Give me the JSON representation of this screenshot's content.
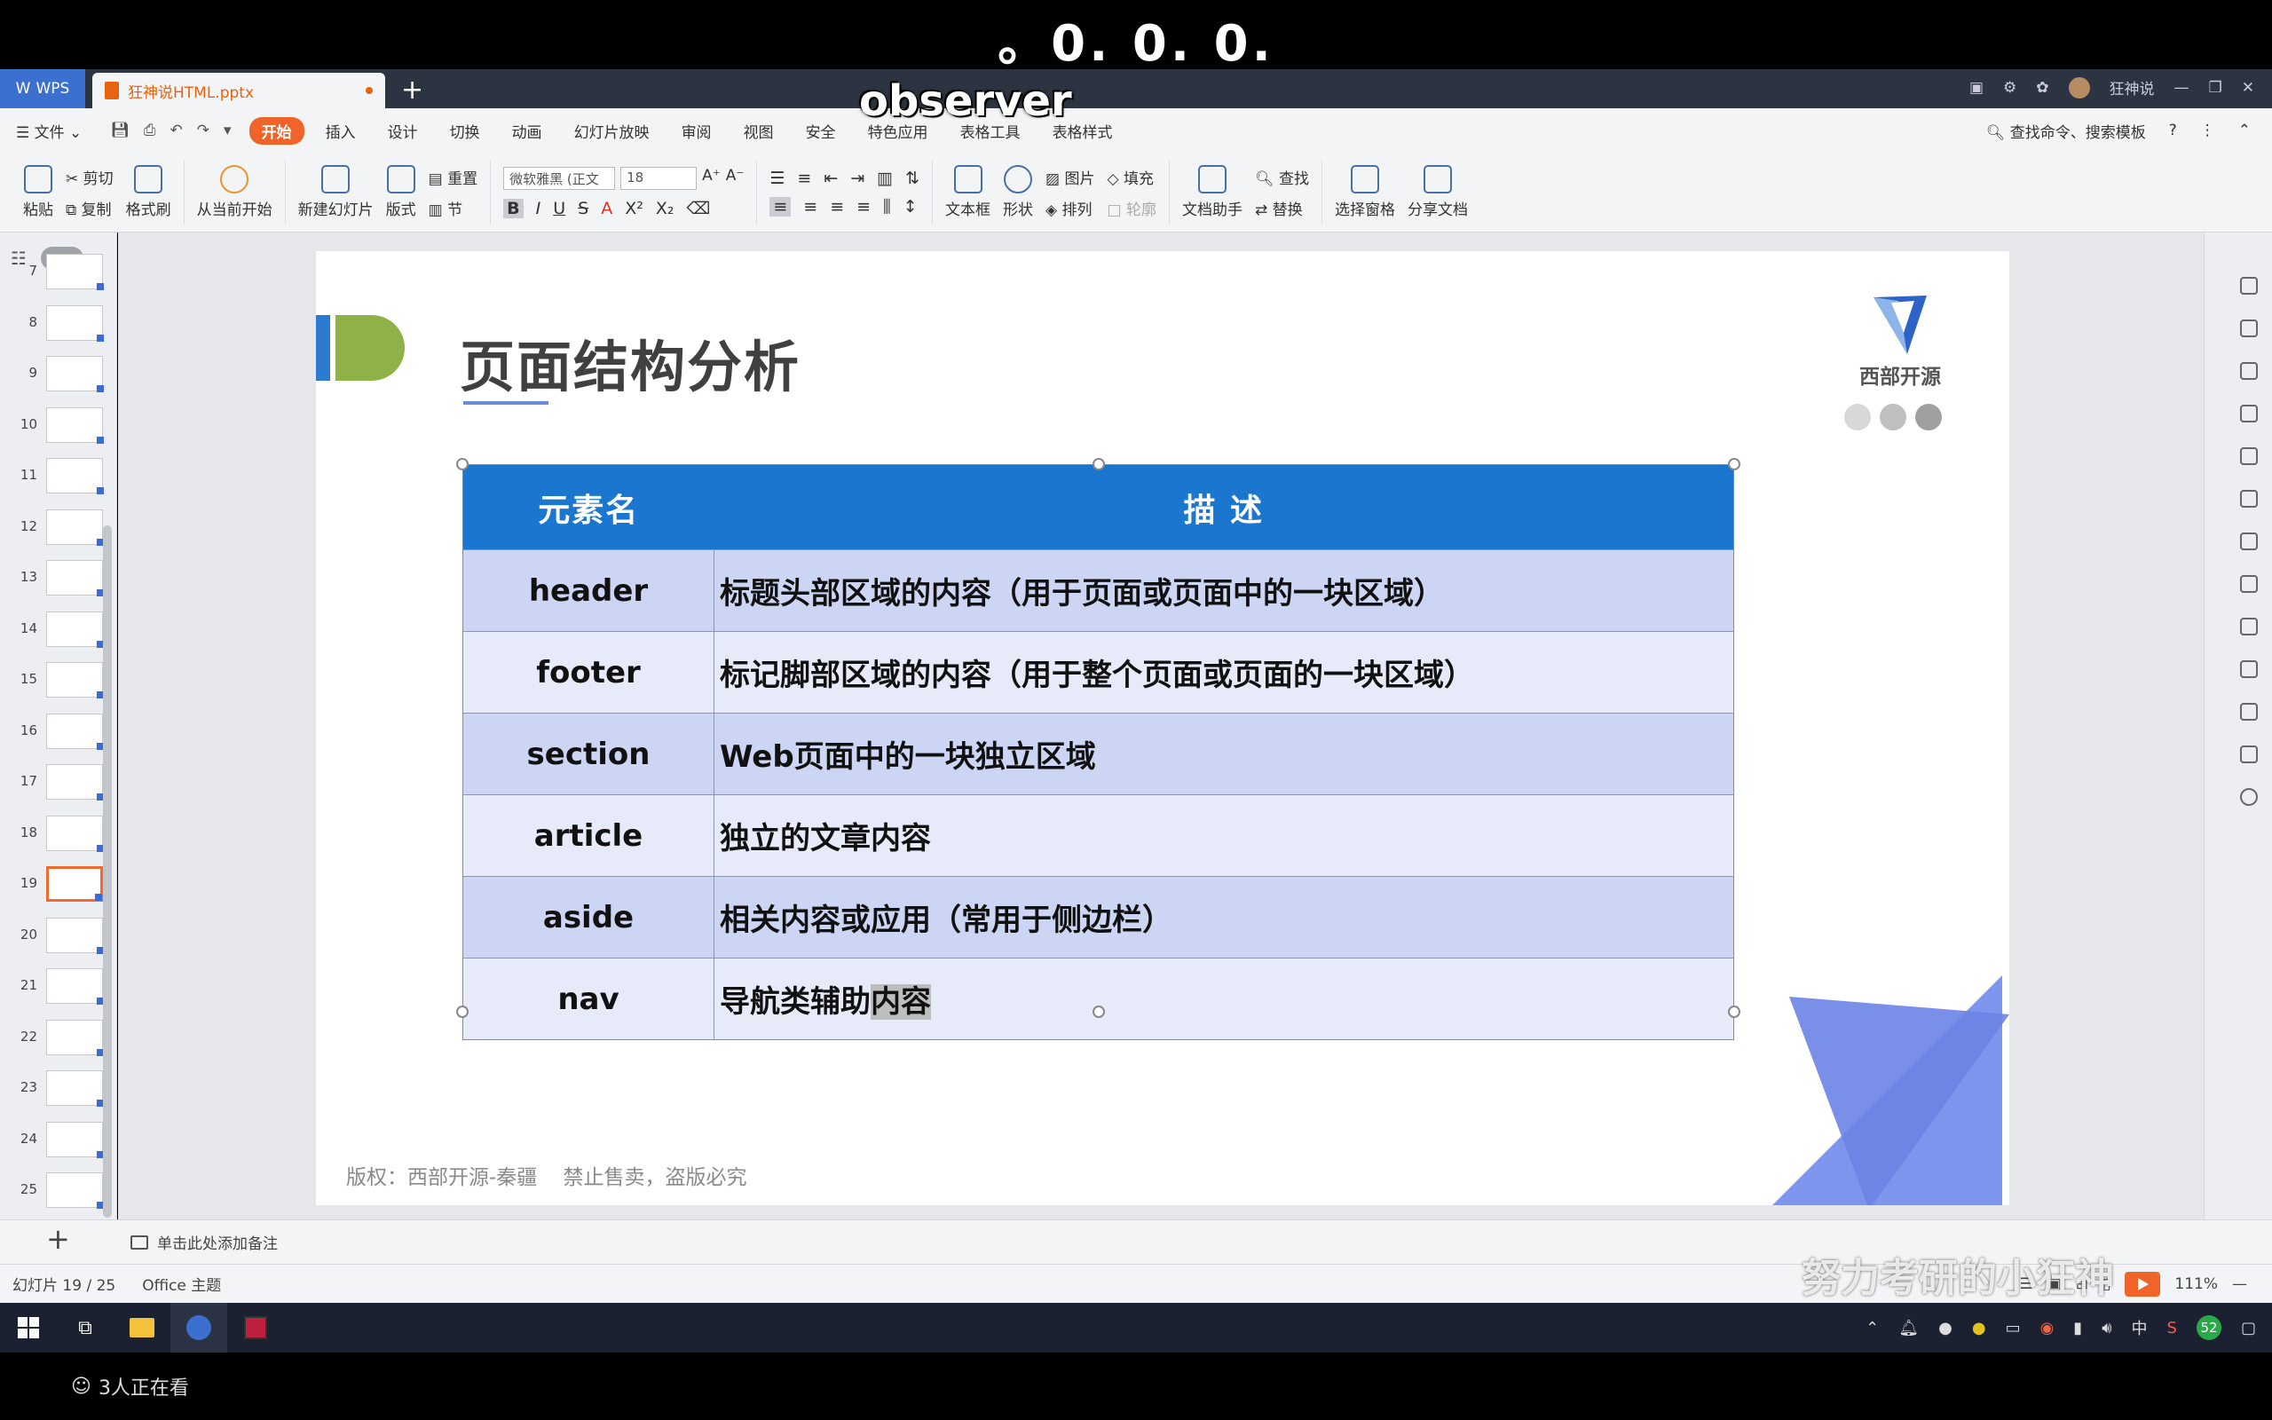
{
  "overlay": {
    "top_caption": "。0. 0. 0.",
    "observer": "observer",
    "watermark": "努力考研的小狂神",
    "viewers": "3人正在看"
  },
  "tabs": {
    "wps": "WPS",
    "document": "狂神说HTML.pptx",
    "user": "狂神说"
  },
  "menu": {
    "file": "文件",
    "items": [
      "开始",
      "插入",
      "设计",
      "切换",
      "动画",
      "幻灯片放映",
      "审阅",
      "视图",
      "安全",
      "特色应用",
      "表格工具",
      "表格样式"
    ],
    "search": "查找命令、搜索模板"
  },
  "ribbon": {
    "paste": "粘贴",
    "cut": "剪切",
    "copy": "复制",
    "format_painter": "格式刷",
    "from_current": "从当前开始",
    "new_slide": "新建幻灯片",
    "layout": "版式",
    "reset": "重置",
    "section": "节",
    "font_name": "微软雅黑 (正文",
    "font_size": "18",
    "text_box": "文本框",
    "shape": "形状",
    "picture": "图片",
    "fill": "填充",
    "arrange": "排列",
    "outline": "轮廓",
    "doc_helper": "文档助手",
    "find": "查找",
    "replace": "替换",
    "select_pane": "选择窗格",
    "share": "分享文档"
  },
  "thumbnails": [
    "7",
    "8",
    "9",
    "10",
    "11",
    "12",
    "13",
    "14",
    "15",
    "16",
    "17",
    "18",
    "19",
    "20",
    "21",
    "22",
    "23",
    "24",
    "25"
  ],
  "active_slide": "19",
  "slide": {
    "title": "页面结构分析",
    "logo_text": "西部开源",
    "copyright": "版权：西部开源-秦疆    禁止售卖，盗版必究",
    "table": {
      "headers": [
        "元素名",
        "描  述"
      ],
      "rows": [
        [
          "header",
          "标题头部区域的内容（用于页面或页面中的一块区域）"
        ],
        [
          "footer",
          "标记脚部区域的内容（用于整个页面或页面的一块区域）"
        ],
        [
          "section",
          "Web页面中的一块独立区域"
        ],
        [
          "article",
          "独立的文章内容"
        ],
        [
          "aside",
          "相关内容或应用（常用于侧边栏）"
        ],
        [
          "nav",
          "导航类辅助内容"
        ]
      ]
    }
  },
  "notes": "单击此处添加备注",
  "status": {
    "slide_counter": "幻灯片 19 / 25",
    "theme": "Office 主题",
    "zoom": "111%"
  },
  "tray": {
    "ime": "中",
    "badge": "52"
  }
}
